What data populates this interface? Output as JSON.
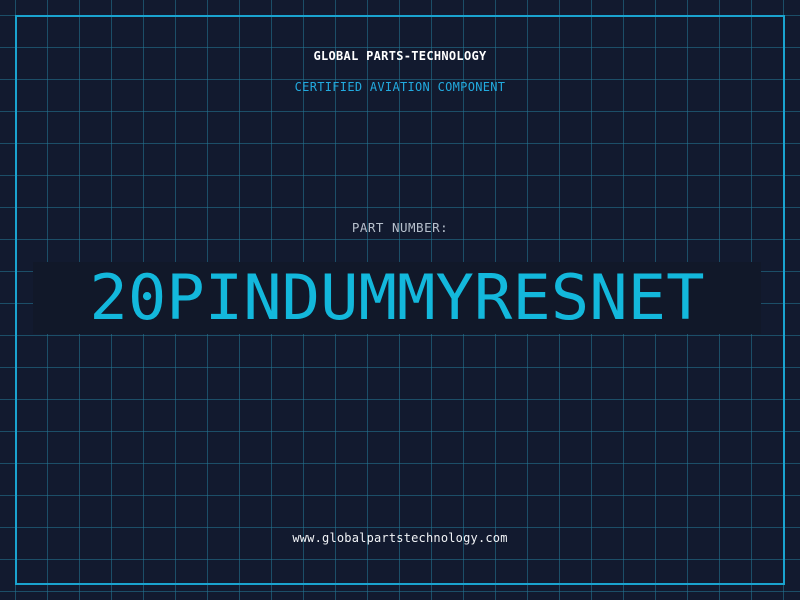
{
  "header": {
    "company": "GLOBAL PARTS-TECHNOLOGY",
    "subtitle": "CERTIFIED AVIATION COMPONENT"
  },
  "part": {
    "label": "PART NUMBER:",
    "number": "20PINDUMMYRESNET"
  },
  "footer": {
    "website": "www.globalpartstechnology.com"
  },
  "colors": {
    "background": "#121a2f",
    "grid": "#247896",
    "frame": "#1aa3cf",
    "accent": "#13b8dc",
    "text": "#ffffff"
  }
}
